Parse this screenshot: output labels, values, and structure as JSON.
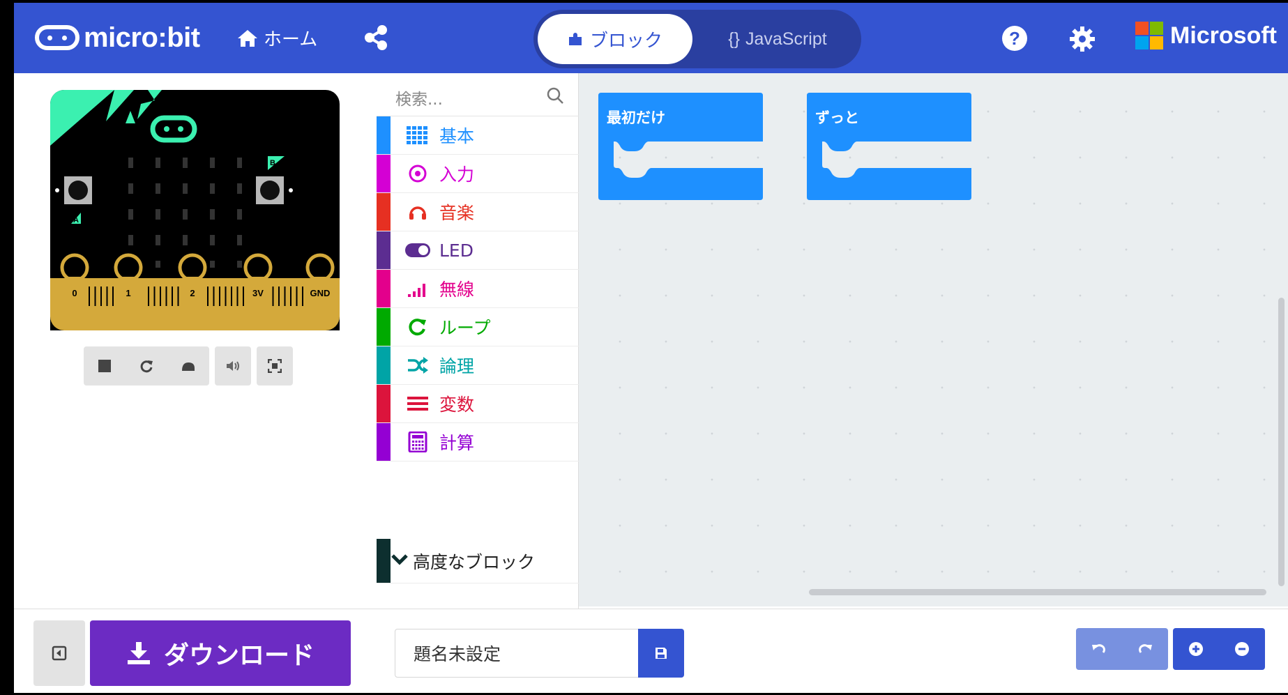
{
  "header": {
    "logo_text": "micro:bit",
    "home_label": "ホーム",
    "blocks_tab": "ブロック",
    "js_tab": "JavaScript",
    "js_braces": "{}",
    "help_label": "?",
    "brand": "Microsoft",
    "colors": {
      "bar": "#3454d1",
      "ms": [
        "#f25022",
        "#7fba00",
        "#00a4ef",
        "#ffb900"
      ]
    }
  },
  "simulator": {
    "pins": [
      "0",
      "1",
      "2",
      "3V",
      "GND"
    ],
    "button_a": "A",
    "button_b": "B",
    "toolbar_icons": [
      "stop-icon",
      "restart-icon",
      "slow-motion-icon",
      "mute-icon",
      "fullscreen-icon"
    ]
  },
  "toolbox": {
    "search_placeholder": "検索...",
    "categories": [
      {
        "label": "基本",
        "color": "#1e90ff",
        "icon": "grid-icon"
      },
      {
        "label": "入力",
        "color": "#d400d4",
        "icon": "target-icon"
      },
      {
        "label": "音楽",
        "color": "#e63022",
        "icon": "headphones-icon"
      },
      {
        "label": "LED",
        "color": "#5c2d91",
        "icon": "toggle-icon"
      },
      {
        "label": "無線",
        "color": "#e3008c",
        "icon": "signal-icon"
      },
      {
        "label": "ループ",
        "color": "#00aa00",
        "icon": "loop-icon"
      },
      {
        "label": "論理",
        "color": "#00a4a6",
        "icon": "shuffle-icon"
      },
      {
        "label": "変数",
        "color": "#dc143c",
        "icon": "lines-icon"
      },
      {
        "label": "計算",
        "color": "#9400d3",
        "icon": "calculator-icon"
      }
    ],
    "advanced_label": "高度なブロック"
  },
  "workspace": {
    "blocks": [
      {
        "label": "最初だけ",
        "color": "#1e90ff"
      },
      {
        "label": "ずっと",
        "color": "#1e90ff"
      }
    ]
  },
  "bottom": {
    "download_label": "ダウンロード",
    "project_name": "題名未設定"
  }
}
